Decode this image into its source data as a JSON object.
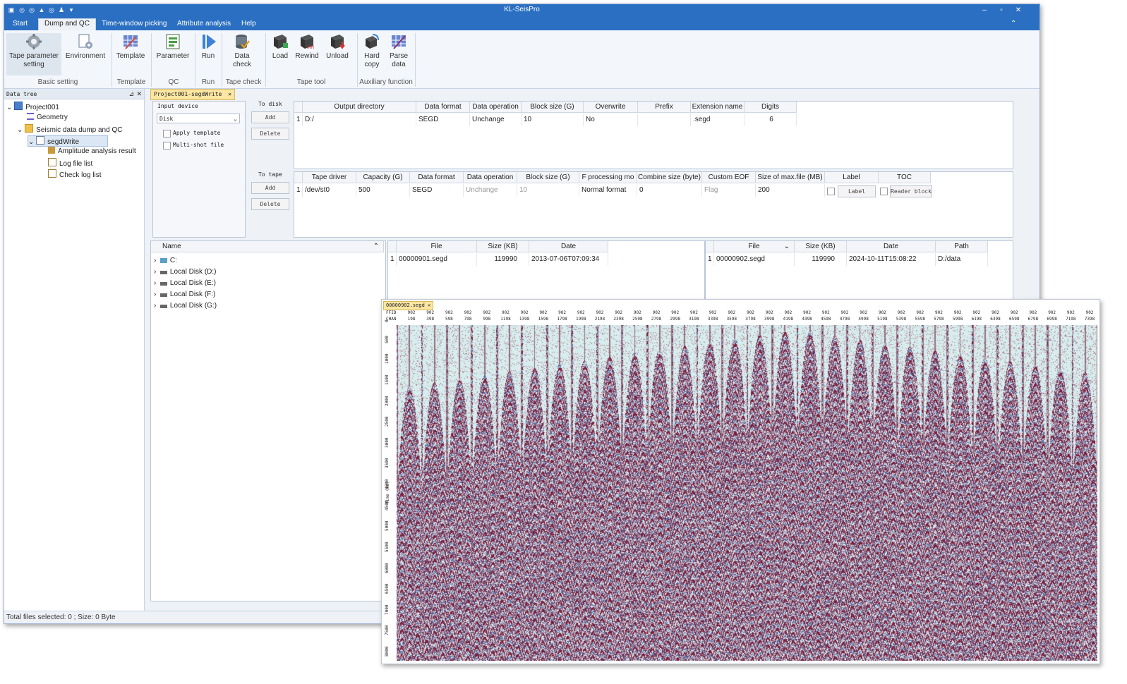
{
  "window": {
    "title": "KL-SeisPro",
    "controls": [
      "–",
      "▫",
      "✕"
    ]
  },
  "menu": [
    "Start",
    "Dump and QC",
    "Time-window picking",
    "Attribute analysis",
    "Help"
  ],
  "ribbon": {
    "buttons": [
      {
        "label": "Tape parameter\nsetting",
        "l1": "Tape parameter",
        "l2": "setting",
        "icon": "gear-icon"
      },
      {
        "label": "Environment",
        "l1": "Environment",
        "l2": "",
        "icon": "environment-icon"
      },
      {
        "label": "Template",
        "l1": "Template",
        "l2": "",
        "icon": "template-icon"
      },
      {
        "label": "Parameter",
        "l1": "Parameter",
        "l2": "",
        "icon": "parameter-icon"
      },
      {
        "label": "Run",
        "l1": "Run",
        "l2": "",
        "icon": "run-icon"
      },
      {
        "label": "Data check",
        "l1": "Data",
        "l2": "check",
        "icon": "data-check-icon"
      },
      {
        "label": "Load",
        "l1": "Load",
        "l2": "",
        "icon": "load-icon"
      },
      {
        "label": "Rewind",
        "l1": "Rewind",
        "l2": "",
        "icon": "rewind-icon"
      },
      {
        "label": "Unload",
        "l1": "Unload",
        "l2": "",
        "icon": "unload-icon"
      },
      {
        "label": "Hard copy",
        "l1": "Hard",
        "l2": "copy",
        "icon": "hard-copy-icon"
      },
      {
        "label": "Parse data",
        "l1": "Parse",
        "l2": "data",
        "icon": "parse-data-icon"
      }
    ],
    "groups": [
      "Basic setting",
      "Template",
      "QC",
      "Run",
      "Tape check",
      "Tape tool",
      "Auxiliary function"
    ]
  },
  "data_tree": {
    "title": "Data tree",
    "items": [
      "Project001",
      "Geometry",
      "Seismic data dump and QC",
      "segdWrite",
      "Amplitude analysis result",
      "Log file list",
      "Check log list"
    ]
  },
  "status": "Total files selected: 0 ; Size: 0 Byte",
  "doc_tab": "Project001-segdWrite",
  "input": {
    "label": "Input device",
    "device": "Disk",
    "apply_template": "Apply template",
    "multishot": "Multi-shot file"
  },
  "disk": {
    "label": "To disk",
    "add": "Add",
    "delete": "Delete",
    "headers": [
      "Output directory",
      "Data format",
      "Data operation",
      "Block size (G)",
      "Overwrite",
      "Prefix",
      "Extension name",
      "Digits"
    ],
    "row": [
      "1",
      "D:/",
      "SEGD",
      "Unchange",
      "10",
      "No",
      "",
      ".segd",
      "6"
    ]
  },
  "tape": {
    "label": "To tape",
    "add": "Add",
    "delete": "Delete",
    "headers": [
      "Tape driver",
      "Capacity (G)",
      "Data format",
      "Data operation",
      "Block size (G)",
      "F processing mo",
      "Combine size (byte)",
      "Custom EOF",
      "Size of max.file (MB)",
      "Label",
      "TOC"
    ],
    "row": [
      "1",
      "/dev/st0",
      "500",
      "SEGD",
      "Unchange",
      "10",
      "Normal format",
      "0",
      "Flag",
      "200",
      "Label",
      "Reader block"
    ]
  },
  "browser": {
    "name_header": "Name",
    "drives": [
      "C:",
      "Local Disk (D:)",
      "Local Disk (E:)",
      "Local Disk (F:)",
      "Local Disk (G:)"
    ]
  },
  "files1": {
    "headers": [
      "File",
      "Size (KB)",
      "Date"
    ],
    "row": [
      "1",
      "00000901.segd",
      "119990",
      "2013-07-06T07:09:34"
    ]
  },
  "files2": {
    "headers": [
      "File",
      "Size (KB)",
      "Date",
      "Path"
    ],
    "row": [
      "1",
      "00000902.segd",
      "119990",
      "2024-10-11T15:08:22",
      "D:/data"
    ]
  },
  "seismic": {
    "tab": "00000902.segd",
    "row_labels": [
      "FFID",
      "CHAN"
    ],
    "ffid": "902",
    "chan_ticks": [
      "198",
      "398",
      "598",
      "798",
      "998",
      "1198",
      "1398",
      "1598",
      "1798",
      "1998",
      "2198",
      "2398",
      "2598",
      "2798",
      "2998",
      "3198",
      "3398",
      "3598",
      "3798",
      "3998",
      "4198",
      "4398",
      "4598",
      "4798",
      "4998",
      "5198",
      "5398",
      "5598",
      "5798",
      "5998",
      "6198",
      "6398",
      "6598",
      "6798",
      "6998",
      "7198",
      "7398"
    ],
    "y_label": "Time (ms)",
    "y_ticks": [
      "0",
      "500",
      "1000",
      "1500",
      "2000",
      "2500",
      "3000",
      "3500",
      "4000",
      "4500",
      "5000",
      "5500",
      "6000",
      "6500",
      "7000",
      "7500",
      "8000"
    ],
    "colors": {
      "wiggle": "#7a1f3d",
      "background": "#d9ecec",
      "trough": "#4f6fa8"
    }
  }
}
